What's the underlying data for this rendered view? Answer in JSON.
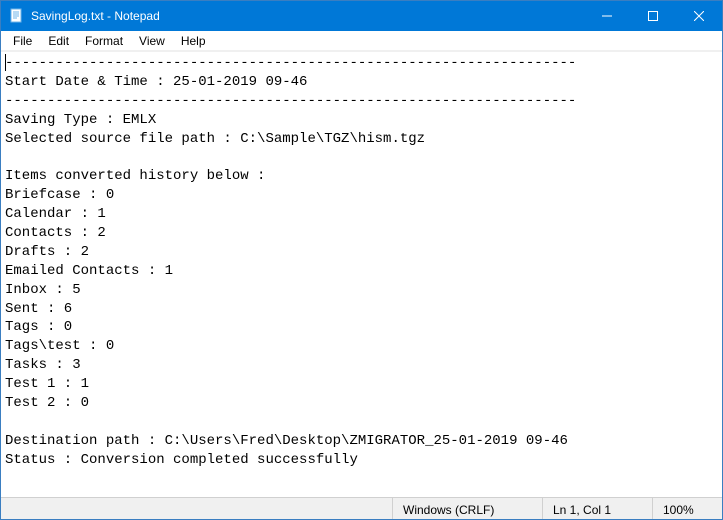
{
  "window": {
    "title": "SavingLog.txt - Notepad"
  },
  "menu": {
    "file": "File",
    "edit": "Edit",
    "format": "Format",
    "view": "View",
    "help": "Help"
  },
  "document": {
    "text": "--------------------------------------------------------------------\nStart Date & Time : 25-01-2019 09-46\n--------------------------------------------------------------------\nSaving Type : EMLX\nSelected source file path : C:\\Sample\\TGZ\\hism.tgz\n\nItems converted history below :\nBriefcase : 0\nCalendar : 1\nContacts : 2\nDrafts : 2\nEmailed Contacts : 1\nInbox : 5\nSent : 6\nTags : 0\nTags\\test : 0\nTasks : 3\nTest 1 : 1\nTest 2 : 0\n\nDestination path : C:\\Users\\Fred\\Desktop\\ZMIGRATOR_25-01-2019 09-46\nStatus : Conversion completed successfully"
  },
  "status": {
    "encoding": "Windows (CRLF)",
    "position": "Ln 1, Col 1",
    "zoom": "100%"
  }
}
